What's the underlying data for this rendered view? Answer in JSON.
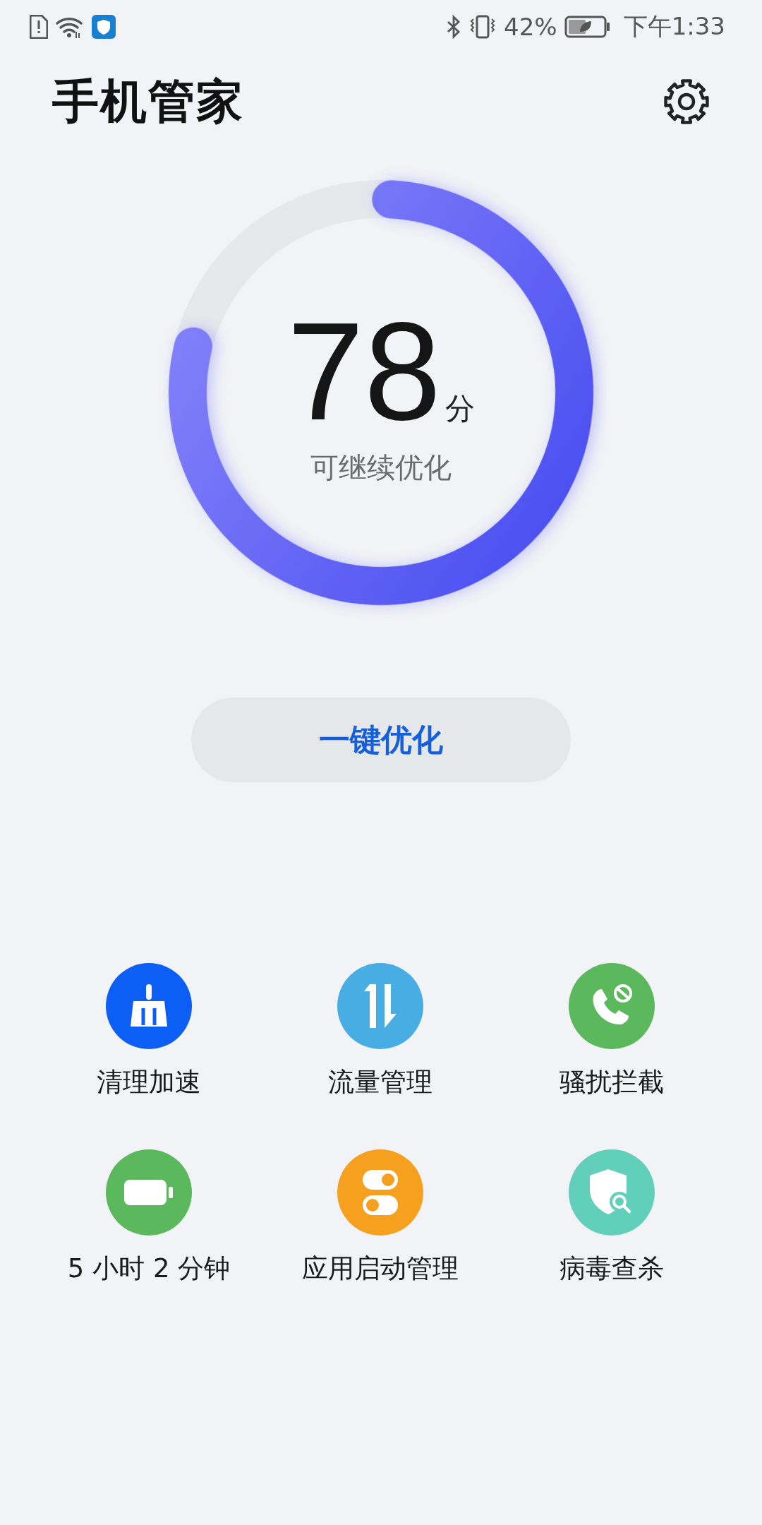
{
  "status_bar": {
    "battery": "42%",
    "time": "下午1:33"
  },
  "header": {
    "title": "手机管家"
  },
  "score": {
    "value": "78",
    "unit": "分",
    "caption": "可继续优化",
    "level": 0.78
  },
  "optimize_button": {
    "label": "一键优化"
  },
  "tools": [
    {
      "kind": "clean",
      "label": "清理加速",
      "color": "#0d5ef5"
    },
    {
      "kind": "traffic",
      "label": "流量管理",
      "color": "#48ade3"
    },
    {
      "kind": "block-call",
      "label": "骚扰拦截",
      "color": "#5cb85c"
    },
    {
      "kind": "battery",
      "label": "5 小时 2 分钟",
      "color": "#5cb85c"
    },
    {
      "kind": "startup",
      "label": "应用启动管理",
      "color": "#f6a01f"
    },
    {
      "kind": "virus",
      "label": "病毒查杀",
      "color": "#62cfbb"
    }
  ]
}
